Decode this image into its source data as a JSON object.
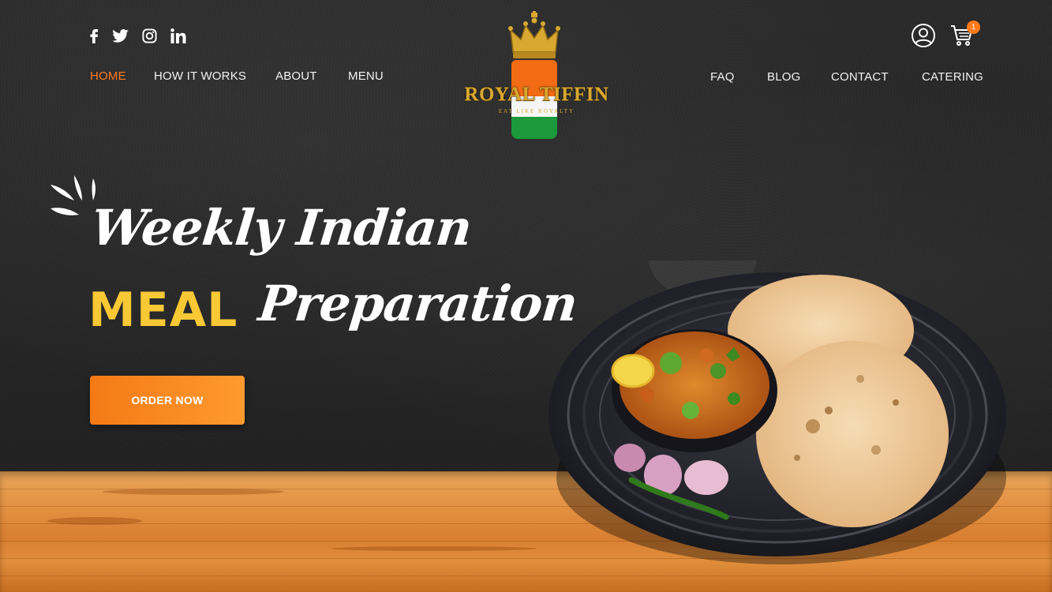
{
  "social": {
    "icons": [
      "facebook-icon",
      "twitter-icon",
      "instagram-icon",
      "linkedin-icon"
    ]
  },
  "nav_left": [
    {
      "label": "HOME",
      "active": true
    },
    {
      "label": "HOW IT WORKS",
      "active": false
    },
    {
      "label": "ABOUT",
      "active": false
    },
    {
      "label": "MENU",
      "active": false
    }
  ],
  "nav_right": [
    {
      "label": "FAQ"
    },
    {
      "label": "BLOG"
    },
    {
      "label": "CONTACT"
    },
    {
      "label": "CATERING"
    }
  ],
  "logo": {
    "brand": "ROYAL TIFFIN",
    "tagline": "EAT LIKE ROYALTY"
  },
  "header_icons": {
    "user": "user-icon",
    "cart": "cart-icon",
    "cart_count": "1"
  },
  "hero": {
    "line1": "Weekly Indian",
    "meal": "MEAL",
    "preparation": "Preparation",
    "cta": "ORDER NOW"
  },
  "colors": {
    "accent": "#ff7a1a",
    "highlight": "#f9c935",
    "gold": "#d9a830",
    "background": "#2a2a2a"
  }
}
